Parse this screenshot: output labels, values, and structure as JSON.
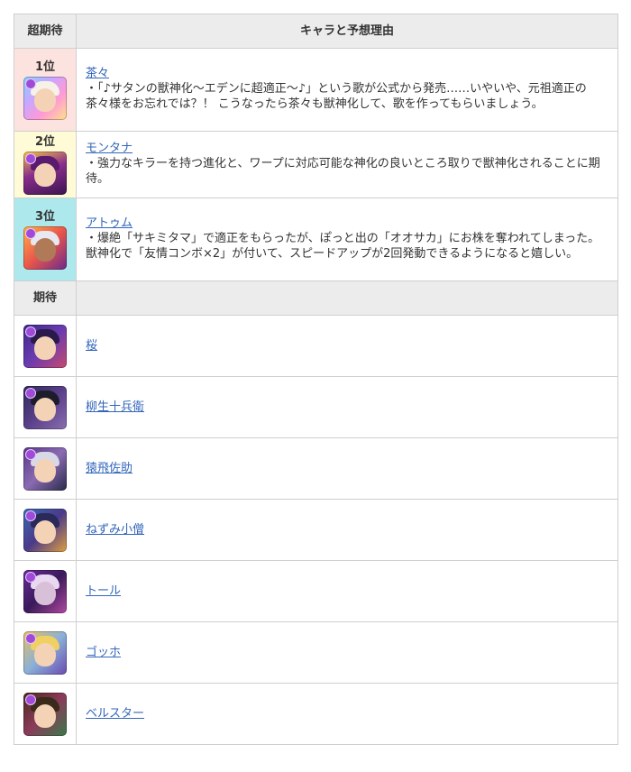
{
  "headers": {
    "col1": "超期待",
    "col2": "キャラと予想理由"
  },
  "ranked": [
    {
      "rank": "1位",
      "name": "茶々",
      "desc": "・「♪サタンの獣神化〜エデンに超適正〜♪」という歌が公式から発売……いやいや、元祖適正の茶々様をお忘れでは？！ こうなったら茶々も獣神化して、歌を作ってもらいましょう。",
      "bg": "#fde3df",
      "icon": "chacha-icon"
    },
    {
      "rank": "2位",
      "name": "モンタナ",
      "desc": "・強力なキラーを持つ進化と、ワープに対応可能な神化の良いところ取りで獣神化されることに期待。",
      "bg": "#fffbd7",
      "icon": "montana-icon"
    },
    {
      "rank": "3位",
      "name": "アトゥム",
      "desc": "・爆絶「サキミタマ」で適正をもらったが、ぽっと出の「オオサカ」にお株を奪われてしまった。獣神化で「友情コンボ×2」が付いて、スピードアップが2回発動できるようになると嬉しい。",
      "bg": "#ade9ec",
      "icon": "atum-icon"
    }
  ],
  "expect_header": "期待",
  "expected": [
    {
      "name": "桜",
      "icon": "sakura-icon"
    },
    {
      "name": "柳生十兵衛",
      "icon": "yagyu-jubei-icon"
    },
    {
      "name": "猿飛佐助",
      "icon": "sarutobi-sasuke-icon"
    },
    {
      "name": "ねずみ小僧",
      "icon": "nezumi-kozo-icon"
    },
    {
      "name": "トール",
      "icon": "thor-icon"
    },
    {
      "name": "ゴッホ",
      "icon": "gogh-icon"
    },
    {
      "name": "ベルスター",
      "icon": "belstar-icon"
    }
  ]
}
